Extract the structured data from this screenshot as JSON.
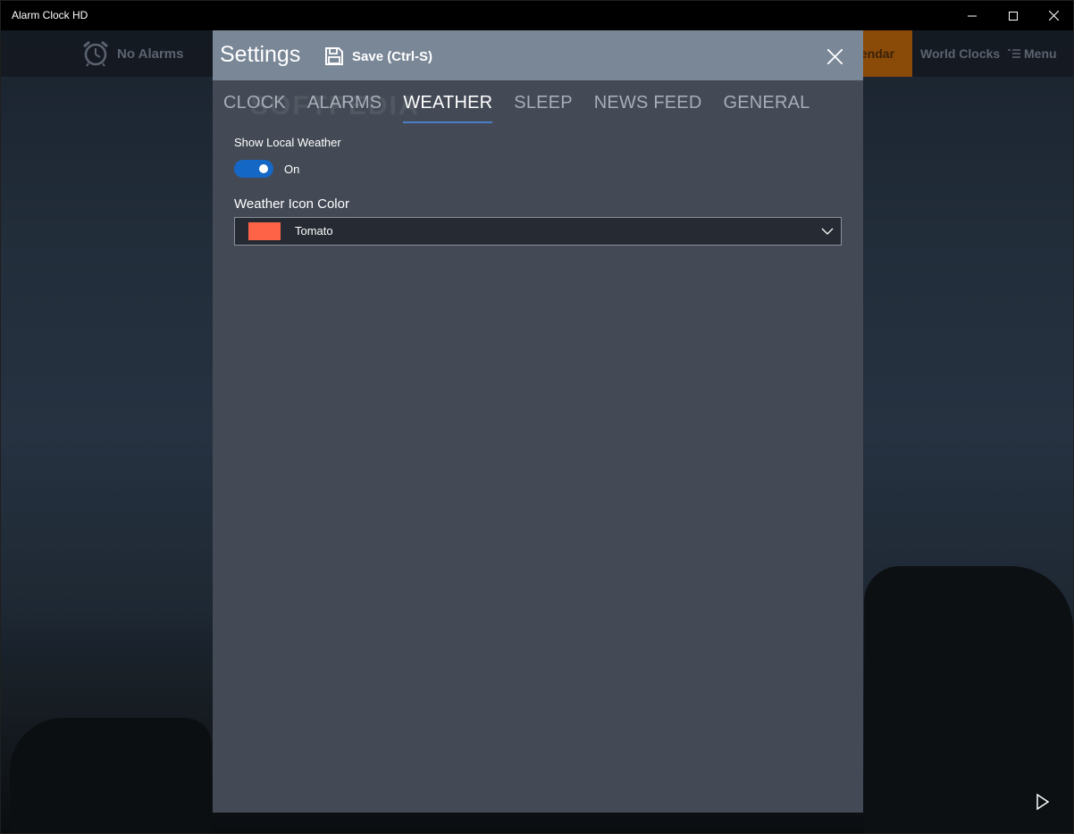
{
  "window": {
    "title": "Alarm Clock HD"
  },
  "appbar": {
    "alarm_status": "No Alarms",
    "calendar_label": "lendar",
    "world_clocks_label": "World Clocks",
    "menu_label": "Menu"
  },
  "settings": {
    "title": "Settings",
    "save_label": "Save (Ctrl-S)",
    "tabs": [
      {
        "label": "CLOCK",
        "active": false
      },
      {
        "label": "ALARMS",
        "active": false
      },
      {
        "label": "WEATHER",
        "active": true
      },
      {
        "label": "SLEEP",
        "active": false
      },
      {
        "label": "NEWS FEED",
        "active": false
      },
      {
        "label": "GENERAL",
        "active": false
      }
    ],
    "watermark": "SOFTPEDIA",
    "weather": {
      "show_local_label": "Show Local Weather",
      "toggle_state": "On",
      "icon_color_label": "Weather Icon Color",
      "icon_color_value": "Tomato",
      "icon_color_hex": "#ff6347"
    }
  },
  "colors": {
    "accent": "#1567c5",
    "dialog_header": "#7a8797",
    "dialog_body": "#434a55",
    "calendar_tab": "#8a4a08"
  },
  "icons": {
    "alarm": "alarm-clock-icon",
    "save": "floppy-disk-icon",
    "close": "close-icon",
    "dropdown": "chevron-down-icon",
    "play": "play-icon",
    "menu": "hamburger-menu-icon"
  }
}
